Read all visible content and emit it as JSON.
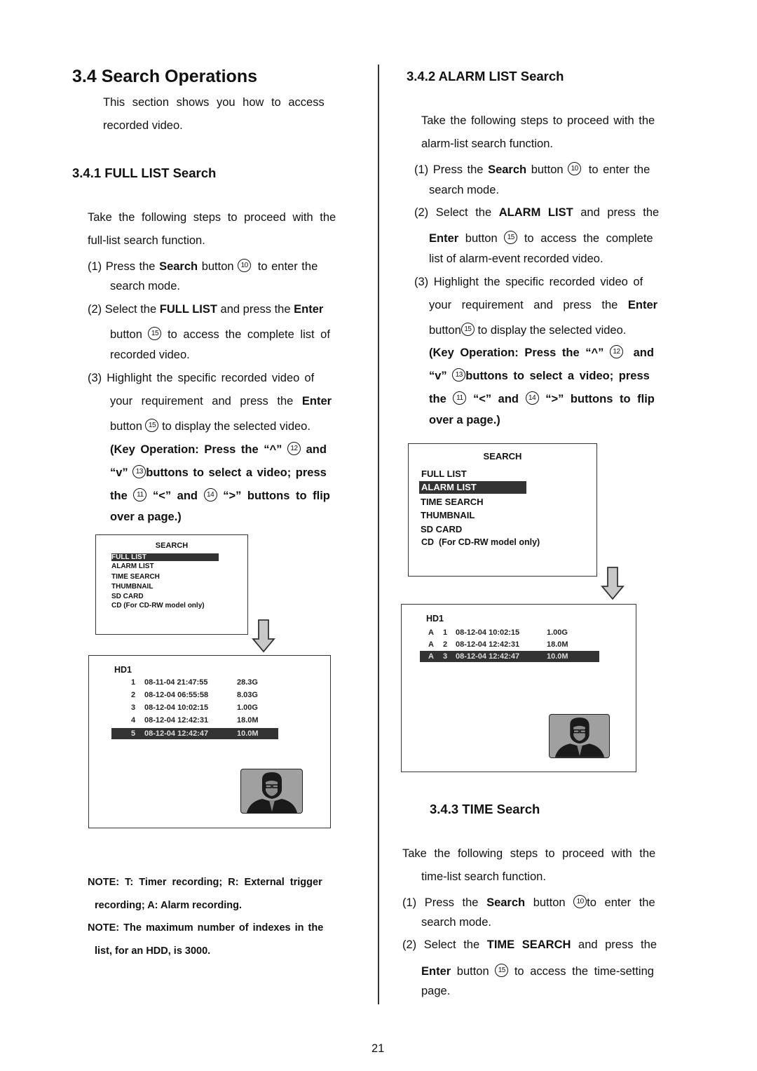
{
  "page": {
    "title": "3.4 Search Operations",
    "intro": [
      "This section shows you how to access",
      "recorded video."
    ],
    "page_number": "21"
  },
  "full_list": {
    "heading": "3.4.1 FULL LIST Search",
    "intro": [
      "Take the following steps to proceed with the",
      "full-list search function."
    ],
    "step1": {
      "num": "(1)",
      "a": "Press the",
      "b": "Search",
      "c": "button",
      "btn": "10",
      "d": "to enter the",
      "e": "search mode."
    },
    "step2": {
      "num": "(2)",
      "a": "Select the",
      "b": "FULL LIST",
      "c": "and press the",
      "d": "Enter",
      "e": "button",
      "btn": "15",
      "f": "to access the complete list of",
      "g": "recorded video."
    },
    "step3": {
      "num": "(3)",
      "a": "Highlight the specific recorded video of",
      "b": "your requirement and press the",
      "c": "Enter",
      "d": "button",
      "btn": "15",
      "e": "to display the selected video."
    },
    "key_op": {
      "l1a": "(Key Operation: Press the “^”",
      "b12": "12",
      "l1b": "and",
      "l2a": "“v”",
      "b13": "13",
      "l2b": "buttons to select a video; press",
      "l3a": "the",
      "b11": "11",
      "l3b": "“<” and",
      "b14": "14",
      "l3c": "“>” buttons to flip",
      "l4": "over a page.)"
    },
    "menu": {
      "title": "SEARCH",
      "items": [
        "FULL LIST",
        "ALARM LIST",
        "TIME SEARCH",
        "THUMBNAIL",
        "SD CARD",
        "CD (For CD-RW model only)"
      ],
      "selected": 0
    },
    "list": {
      "drive": "HD1",
      "rows": [
        {
          "idx": "1",
          "datetime": "08-11-04 21:47:55",
          "size": "28.3G"
        },
        {
          "idx": "2",
          "datetime": "08-12-04 06:55:58",
          "size": "8.03G"
        },
        {
          "idx": "3",
          "datetime": "08-12-04 10:02:15",
          "size": "1.00G"
        },
        {
          "idx": "4",
          "datetime": "08-12-04 12:42:31",
          "size": "18.0M"
        },
        {
          "idx": "5",
          "datetime": "08-12-04 12:42:47",
          "size": "10.0M"
        }
      ],
      "selected": 4
    },
    "notes": [
      [
        "NOTE: T: Timer recording; R: External trigger",
        "recording; A: Alarm recording."
      ],
      [
        "NOTE: The maximum number of indexes in the",
        "list, for an HDD, is 3000."
      ]
    ]
  },
  "alarm_list": {
    "heading": "3.4.2 ALARM LIST Search",
    "intro": [
      "Take the following steps to proceed with the",
      "alarm-list search function."
    ],
    "step1": {
      "num": "(1)",
      "a": "Press the",
      "b": "Search",
      "c": "button",
      "btn": "10",
      "d": "to enter the",
      "e": "search mode."
    },
    "step2": {
      "num": "(2)",
      "a": "Select the",
      "b": "ALARM LIST",
      "c": "and press the",
      "d": "Enter",
      "e": "button",
      "btn": "15",
      "f": "to access the complete",
      "g": "list of alarm-event recorded video."
    },
    "step3": {
      "num": "(3)",
      "a": "Highlight the specific recorded video of",
      "b": "your requirement and press the",
      "c": "Enter",
      "d": "button",
      "btn": "15",
      "e": "to display the selected video."
    },
    "key_op": {
      "l1a": "(Key Operation: Press the “^”",
      "b12": "12",
      "l1b": "and",
      "l2a": "“v”",
      "b13": "13",
      "l2b": "buttons to select a video; press",
      "l3a": "the",
      "b11": "11",
      "l3b": "“<” and",
      "b14": "14",
      "l3c": "“>” buttons to flip",
      "l4": "over a page.)"
    },
    "menu": {
      "title": "SEARCH",
      "items": [
        "FULL LIST",
        "ALARM LIST",
        "TIME SEARCH",
        "THUMBNAIL",
        "SD CARD",
        "CD  (For CD-RW model only)"
      ],
      "selected": 1
    },
    "list": {
      "drive": "HD1",
      "rows": [
        {
          "type": "A",
          "idx": "1",
          "datetime": "08-12-04 10:02:15",
          "size": "1.00G"
        },
        {
          "type": "A",
          "idx": "2",
          "datetime": "08-12-04 12:42:31",
          "size": "18.0M"
        },
        {
          "type": "A",
          "idx": "3",
          "datetime": "08-12-04 12:42:47",
          "size": "10.0M"
        }
      ],
      "selected": 2
    }
  },
  "time_search": {
    "heading": "3.4.3 TIME Search",
    "intro": [
      "Take the following steps to proceed with the",
      "time-list search function."
    ],
    "step1": {
      "num": "(1)",
      "a": "Press the",
      "b": "Search",
      "c": "button",
      "btn": "10",
      "d": "to enter the",
      "e": "search mode."
    },
    "step2": {
      "num": "(2)",
      "a": "Select the",
      "b": "TIME SEARCH",
      "c": "and press the",
      "d": "Enter",
      "e": "button",
      "btn": "15",
      "f": "to access the time-setting",
      "g": "page."
    }
  }
}
